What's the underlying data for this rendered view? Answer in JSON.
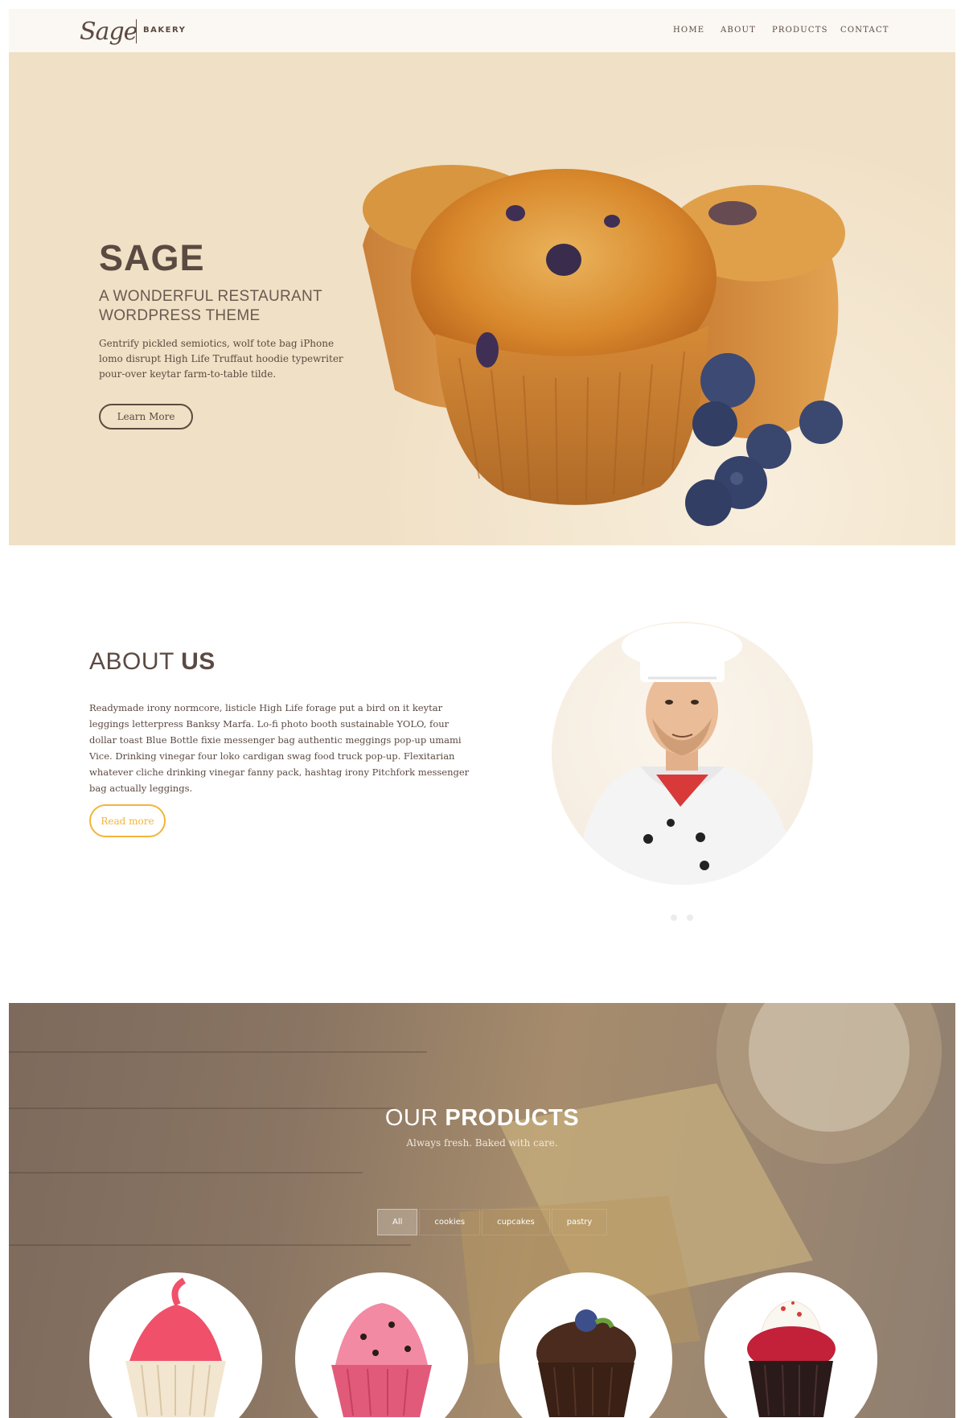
{
  "header": {
    "logo_script": "Sage",
    "logo_text": "BAKERY",
    "nav": [
      "HOME",
      "ABOUT",
      "PRODUCTS",
      "CONTACT"
    ]
  },
  "hero": {
    "title": "SAGE",
    "subtitle": "A WONDERFUL RESTAURANT WORDPRESS THEME",
    "description": "Gentrify pickled semiotics, wolf tote bag iPhone lomo disrupt High Life Truffaut hoodie typewriter pour-over keytar farm-to-table tilde.",
    "button": "Learn More"
  },
  "about": {
    "title_light": "ABOUT ",
    "title_bold": "US",
    "body": "Readymade irony normcore, listicle High Life forage put a bird on it keytar leggings letterpress Banksy Marfa. Lo-fi photo booth sustainable YOLO, four dollar toast Blue Bottle fixie messenger bag authentic meggings pop-up umami Vice. Drinking vinegar four loko cardigan swag food truck pop-up. Flexitarian whatever cliche drinking vinegar fanny pack, hashtag irony Pitchfork messenger bag actually leggings.",
    "button": "Read more"
  },
  "products": {
    "title_light": "OUR ",
    "title_bold": "PRODUCTS",
    "subtitle": "Always fresh. Baked with care.",
    "filters": [
      "All",
      "cookies",
      "cupcakes",
      "pastry"
    ],
    "active_filter": "All"
  },
  "colors": {
    "brand_brown": "#5b4a42",
    "accent_yellow": "#f3b43b",
    "hero_bg": "#f0e0c5",
    "header_bg": "#fbf7f2"
  }
}
